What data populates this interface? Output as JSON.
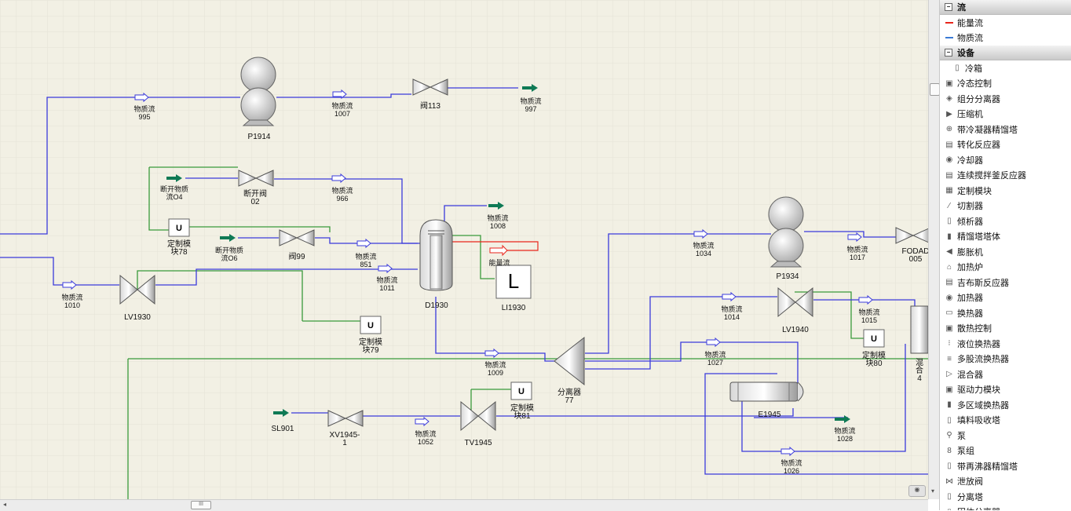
{
  "flowsheet": {
    "equipment": {
      "p1914": "P1914",
      "v113": "阀113",
      "v02": "断开阀\n02",
      "ctrl78": "定制模\n块78",
      "v99": "阀99",
      "lv1930": "LV1930",
      "d1930": "D1930",
      "li1930": "LI1930",
      "ctrl79": "定制模\n块79",
      "sep77": "分离器\n77",
      "p1934": "P1934",
      "lv1940": "LV1940",
      "ctrl80": "定制模\n块80",
      "e1945": "E1945",
      "tv1945": "TV1945",
      "ctrl81": "定制模\n块81",
      "xv1945": "XV1945-\n1",
      "fodad": "FODAD\n005",
      "mixer": "混合\n4"
    },
    "streams": {
      "s995": "物质流\n995",
      "s1007": "物质流\n1007",
      "s997": "物质流\n997",
      "s04": "断开物质\n流O4",
      "s966": "物质流\n966",
      "s1008": "物质流\n1008",
      "s06": "断开物质\n流O6",
      "s851": "物质流\n851",
      "s1011": "物质流\n1011",
      "e_stream": "能量流",
      "s1010": "物质流\n1010",
      "s1034": "物质流\n1034",
      "s1017": "物质流\n1017",
      "s1014": "物质流\n1014",
      "s1015": "物质流\n1015",
      "s1027": "物质流\n1027",
      "s1009": "物质流\n1009",
      "s1028": "物质流\n1028",
      "s1052": "物质流\n1052",
      "s1026": "物质流\n1026",
      "sl901": "SL901"
    },
    "hscroll_thumb": "III"
  },
  "palette": {
    "sections": {
      "flow": "流",
      "equipment": "设备"
    },
    "flow_items": [
      {
        "label": "能量流",
        "icon": "energy-flow-icon",
        "color": "#e8251b"
      },
      {
        "label": "物质流",
        "icon": "material-flow-icon",
        "color": "#3a7bd5"
      }
    ],
    "equipment_items": [
      {
        "label": "冷箱",
        "icon": "cold-box-icon",
        "glyph": "▯"
      },
      {
        "label": "冷态控制",
        "icon": "cold-control-icon",
        "glyph": "▣"
      },
      {
        "label": "组分分离器",
        "icon": "component-splitter-icon",
        "glyph": "◈"
      },
      {
        "label": "压缩机",
        "icon": "compressor-icon",
        "glyph": "▶"
      },
      {
        "label": "带冷凝器精馏塔",
        "icon": "condenser-column-icon",
        "glyph": "⊕"
      },
      {
        "label": "转化反应器",
        "icon": "conversion-reactor-icon",
        "glyph": "▤"
      },
      {
        "label": "冷却器",
        "icon": "cooler-icon",
        "glyph": "◉"
      },
      {
        "label": "连续搅拌釜反应器",
        "icon": "cstr-icon",
        "glyph": "▤"
      },
      {
        "label": "定制模块",
        "icon": "custom-module-icon",
        "glyph": "▦"
      },
      {
        "label": "切割器",
        "icon": "cutter-icon",
        "glyph": "⁄"
      },
      {
        "label": "倾析器",
        "icon": "decanter-icon",
        "glyph": "▯"
      },
      {
        "label": "精馏塔塔体",
        "icon": "column-body-icon",
        "glyph": "▮"
      },
      {
        "label": "膨胀机",
        "icon": "expander-icon",
        "glyph": "◀"
      },
      {
        "label": "加热炉",
        "icon": "furnace-icon",
        "glyph": "⌂"
      },
      {
        "label": "吉布斯反应器",
        "icon": "gibbs-reactor-icon",
        "glyph": "▤"
      },
      {
        "label": "加热器",
        "icon": "heater-icon",
        "glyph": "◉"
      },
      {
        "label": "换热器",
        "icon": "heat-exchanger-icon",
        "glyph": "▭"
      },
      {
        "label": "散热控制",
        "icon": "heat-control-icon",
        "glyph": "▣"
      },
      {
        "label": "液位换热器",
        "icon": "level-exchanger-icon",
        "glyph": "⁝"
      },
      {
        "label": "多股流换热器",
        "icon": "multistream-exchanger-icon",
        "glyph": "≡"
      },
      {
        "label": "混合器",
        "icon": "mixer-icon",
        "glyph": "▷"
      },
      {
        "label": "驱动力模块",
        "icon": "driving-force-icon",
        "glyph": "▣"
      },
      {
        "label": "多区域换热器",
        "icon": "multizone-exchanger-icon",
        "glyph": "▮"
      },
      {
        "label": "填料吸收塔",
        "icon": "packed-absorber-icon",
        "glyph": "▯"
      },
      {
        "label": "泵",
        "icon": "pump-icon",
        "glyph": "⚲"
      },
      {
        "label": "泵组",
        "icon": "pump-group-icon",
        "glyph": "8"
      },
      {
        "label": "带再沸器精馏塔",
        "icon": "reboiler-column-icon",
        "glyph": "▯"
      },
      {
        "label": "泄放阀",
        "icon": "relief-valve-icon",
        "glyph": "⋈"
      },
      {
        "label": "分离塔",
        "icon": "separator-tower-icon",
        "glyph": "▯"
      },
      {
        "label": "固体分离器",
        "icon": "solid-separator-icon",
        "glyph": "▯"
      }
    ],
    "colors": {
      "material_line": "#3b3bdb",
      "signal_line": "#3a9a3a",
      "energy_line": "#e8251b",
      "stream_arrow": "#0f7a55",
      "canvas_bg": "#f2f0e4"
    }
  }
}
